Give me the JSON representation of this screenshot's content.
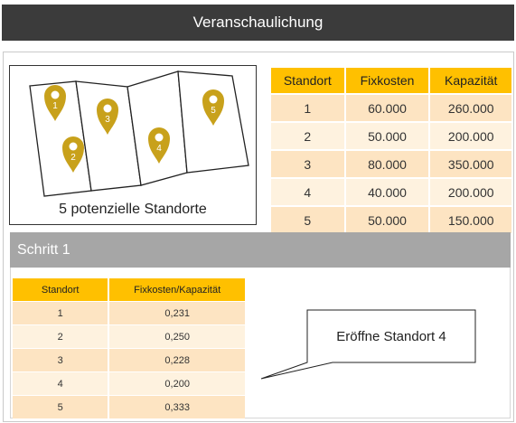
{
  "header": {
    "title": "Veranschaulichung"
  },
  "map": {
    "caption": "5 potenzielle Standorte",
    "pins": [
      "1",
      "2",
      "3",
      "4",
      "5"
    ],
    "pin_color": "#c8a11b"
  },
  "locations_table": {
    "headers": [
      "Standort",
      "Fixkosten",
      "Kapazität"
    ],
    "rows": [
      [
        "1",
        "60.000",
        "260.000"
      ],
      [
        "2",
        "50.000",
        "200.000"
      ],
      [
        "3",
        "80.000",
        "350.000"
      ],
      [
        "4",
        "40.000",
        "200.000"
      ],
      [
        "5",
        "50.000",
        "150.000"
      ]
    ]
  },
  "step": {
    "title": "Schritt 1",
    "table": {
      "headers": [
        "Standort",
        "Fixkosten/Kapazität"
      ],
      "rows": [
        [
          "1",
          "0,231"
        ],
        [
          "2",
          "0,250"
        ],
        [
          "3",
          "0,228"
        ],
        [
          "4",
          "0,200"
        ],
        [
          "5",
          "0,333"
        ]
      ]
    },
    "callout": "Eröffne Standort 4"
  },
  "colors": {
    "header_bg": "#3b3b3b",
    "accent": "#ffc000",
    "row_dark": "#fde4c2",
    "row_light": "#fef2df",
    "step_bar": "#a6a6a6"
  }
}
